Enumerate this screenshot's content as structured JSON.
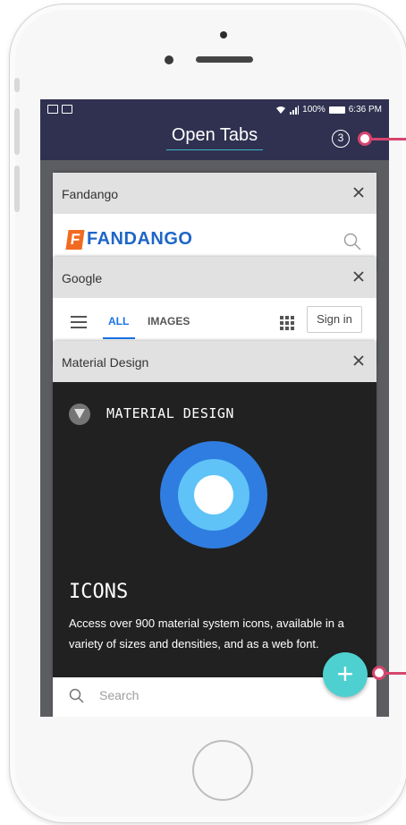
{
  "status_bar": {
    "wifi": "wifi-icon",
    "signal": "signal-icon",
    "battery_percent": "100%",
    "time": "6:36 PM"
  },
  "app_bar": {
    "title": "Open Tabs",
    "tab_count": "3"
  },
  "tabs": [
    {
      "title": "Fandango",
      "page": {
        "logo_letter": "F",
        "logo_text": "FANDANGO"
      }
    },
    {
      "title": "Google",
      "page": {
        "nav_all": "ALL",
        "nav_images": "IMAGES",
        "sign_in": "Sign in"
      }
    },
    {
      "title": "Material Design",
      "page": {
        "brand": "MATERIAL DESIGN",
        "heading": "ICONS",
        "description": "Access over 900 material system icons, available in a variety of sizes and densities, and as a web font.",
        "search_placeholder": "Search"
      }
    }
  ],
  "fab": {
    "label": "+"
  },
  "colors": {
    "app_bar": "#303150",
    "accent": "#4fd0d0",
    "annotation": "#d6456e",
    "fandango_orange": "#f26a21",
    "fandango_blue": "#1e66c7",
    "google_blue": "#1a73e8",
    "material_dark": "#212121",
    "ring_outer": "#2f7de1",
    "ring_inner": "#5fc3f7"
  }
}
